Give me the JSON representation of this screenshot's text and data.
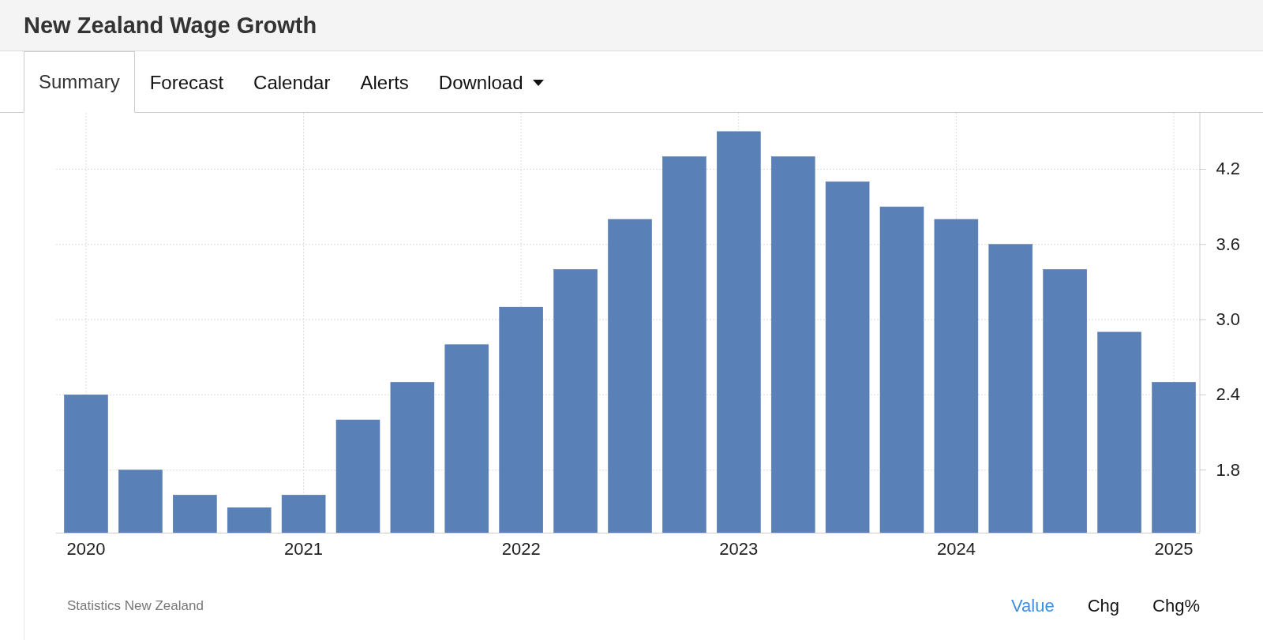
{
  "header": {
    "title": "New Zealand Wage Growth"
  },
  "tabs": [
    {
      "label": "Summary",
      "selected": true,
      "caret": false
    },
    {
      "label": "Forecast",
      "selected": false,
      "caret": false
    },
    {
      "label": "Calendar",
      "selected": false,
      "caret": false
    },
    {
      "label": "Alerts",
      "selected": false,
      "caret": false
    },
    {
      "label": "Download",
      "selected": false,
      "caret": true
    }
  ],
  "chart": {
    "chart_data": {
      "type": "bar",
      "categories": [
        "2020",
        null,
        null,
        null,
        "2021",
        null,
        null,
        null,
        "2022",
        null,
        null,
        null,
        "2023",
        null,
        null,
        null,
        "2024",
        null,
        null,
        null,
        "2025"
      ],
      "series": [
        {
          "color": "#5a80b8",
          "values": [
            2.4,
            1.8,
            1.6,
            1.5,
            1.6,
            2.2,
            2.5,
            2.8,
            3.1,
            3.4,
            3.8,
            4.3,
            4.5,
            4.3,
            4.1,
            3.9,
            3.8,
            3.6,
            3.4,
            2.9,
            2.5
          ]
        }
      ],
      "ylim": [
        1.3,
        4.65
      ],
      "grid": true,
      "yticks": [
        {
          "value": 1.8,
          "label": "1.8"
        },
        {
          "value": 2.4,
          "label": "2.4"
        },
        {
          "value": 3,
          "label": "3.0"
        },
        {
          "value": 3.6,
          "label": "3.6"
        },
        {
          "value": 4.2,
          "label": "4.2"
        }
      ]
    }
  },
  "source": "Statistics New Zealand",
  "view_options": [
    {
      "label": "Value",
      "selected": true
    },
    {
      "label": "Chg",
      "selected": false
    },
    {
      "label": "Chg%",
      "selected": false
    }
  ]
}
